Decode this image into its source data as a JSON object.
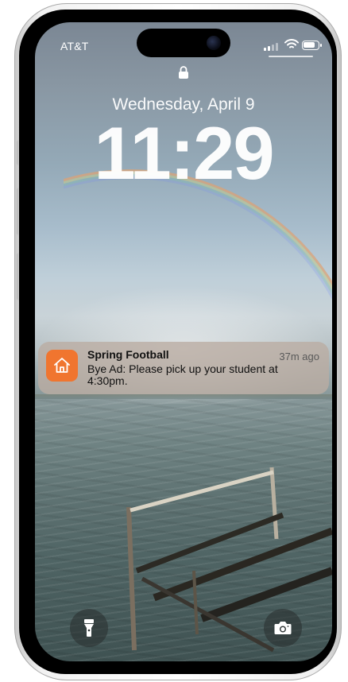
{
  "status_bar": {
    "carrier": "AT&T",
    "signal_bars": 2,
    "wifi": "wifi-icon",
    "battery_level": 0.8
  },
  "lock_screen": {
    "date": "Wednesday, April 9",
    "time": "11:29"
  },
  "notification": {
    "app_icon": "home-icon",
    "accent": "#f0752f",
    "title": "Spring Football",
    "time": "37m ago",
    "body": "Bye Ad: Please pick up your student at 4:30pm."
  },
  "quick_actions": {
    "left": "flashlight-icon",
    "right": "camera-icon"
  }
}
